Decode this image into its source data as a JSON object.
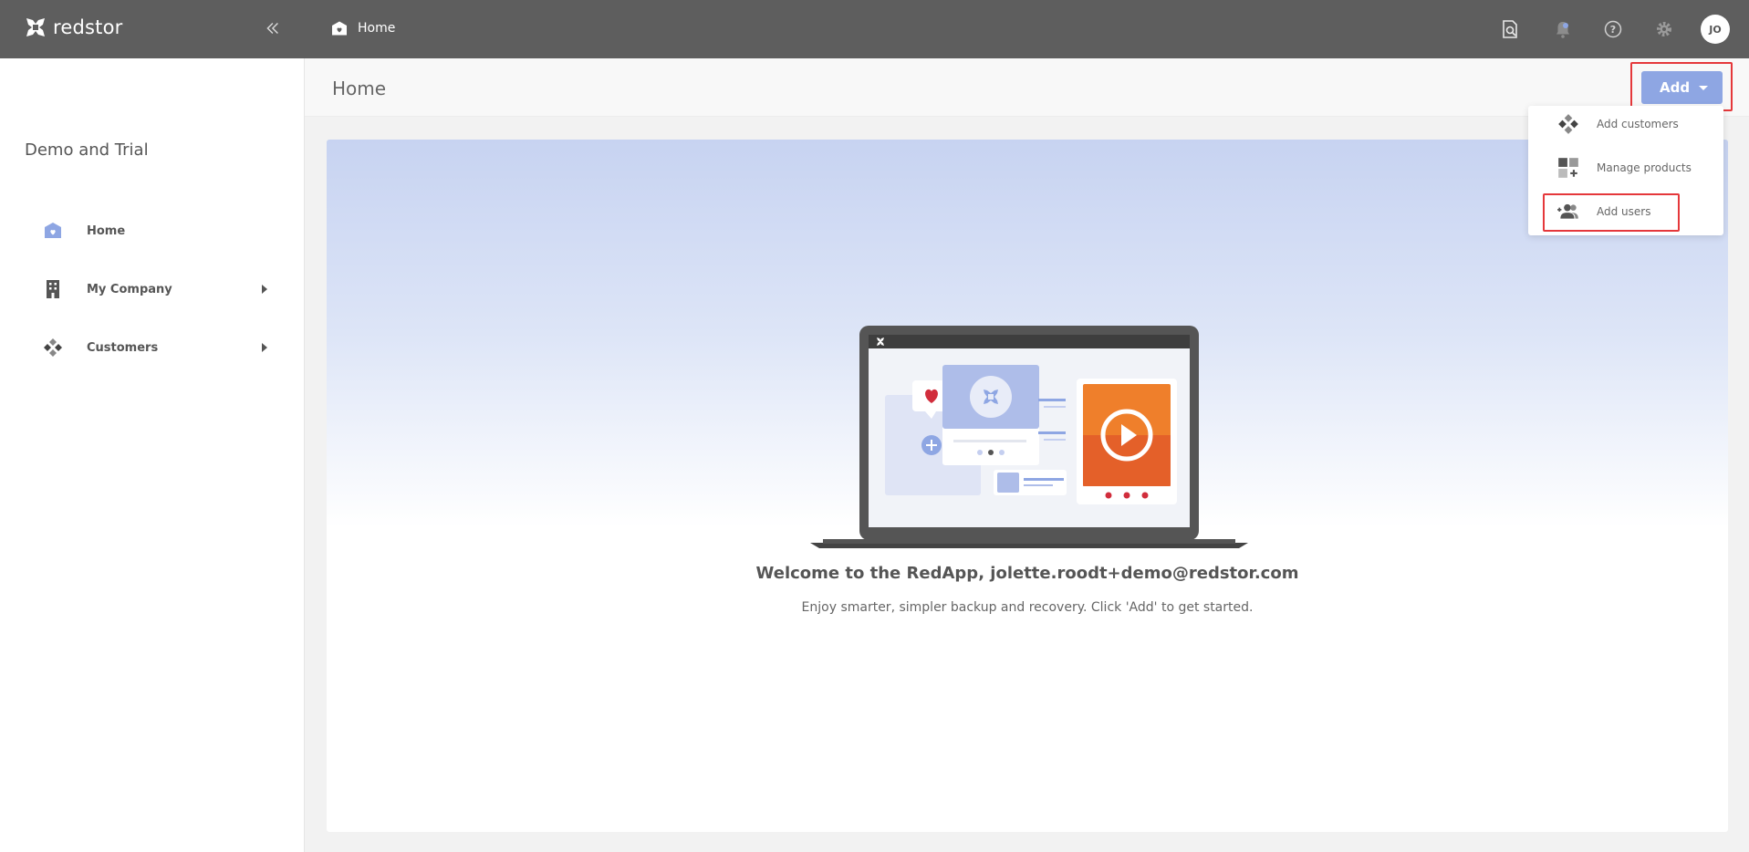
{
  "app": {
    "brand": "redstor"
  },
  "topbar": {
    "breadcrumb": "Home",
    "avatar_initials": "JO",
    "icons": [
      "search-doc-icon",
      "notification-bell-icon",
      "help-icon",
      "settings-gear-icon"
    ]
  },
  "sidebar": {
    "org_name": "Demo and Trial",
    "items": [
      {
        "label": "Home",
        "icon": "home-heart-icon",
        "expandable": false
      },
      {
        "label": "My Company",
        "icon": "building-icon",
        "expandable": true
      },
      {
        "label": "Customers",
        "icon": "customers-diamond-icon",
        "expandable": true
      }
    ]
  },
  "header": {
    "title": "Home",
    "add_label": "Add"
  },
  "add_menu": {
    "items": [
      {
        "label": "Add customers",
        "icon": "customers-diamond-icon"
      },
      {
        "label": "Manage products",
        "icon": "products-grid-icon"
      },
      {
        "label": "Add users",
        "icon": "add-users-icon"
      }
    ]
  },
  "main": {
    "welcome": "Welcome to the RedApp, jolette.roodt+demo@redstor.com",
    "subtext": "Enjoy smarter, simpler backup and recovery. Click 'Add' to get started."
  },
  "colors": {
    "topbar": "#5e5e5e",
    "accent": "#8ea6e3",
    "highlight": "#e5383b",
    "video_orange": "#ef7f2b",
    "video_red": "#d63a2a"
  }
}
